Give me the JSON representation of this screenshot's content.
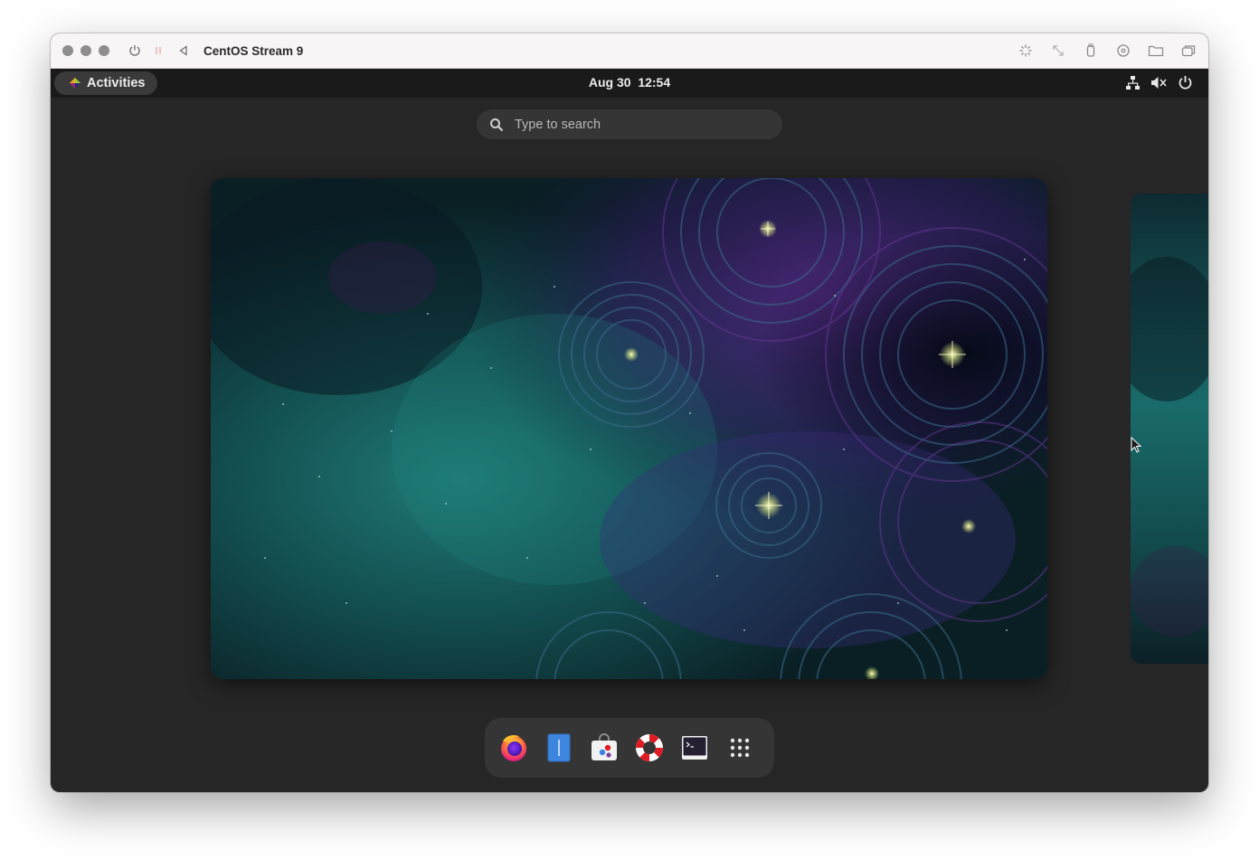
{
  "window": {
    "title": "CentOS Stream 9"
  },
  "topbar": {
    "activities_label": "Activities",
    "clock": "Aug 30  12:54"
  },
  "search": {
    "placeholder": "Type to search"
  },
  "dash": {
    "items": [
      "firefox-icon",
      "text-editor-icon",
      "software-icon",
      "help-icon",
      "terminal-icon",
      "app-grid-icon"
    ]
  },
  "colors": {
    "panel": "#1a1a1a",
    "overview_bg": "#262626",
    "dash_bg": "#353535",
    "nebula_teal": "#1a6b6b",
    "nebula_purple": "#4a1a6e"
  }
}
